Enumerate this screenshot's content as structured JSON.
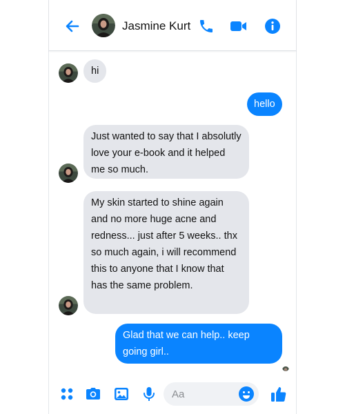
{
  "header": {
    "contact_name": "Jasmine Kurt",
    "icons": [
      "back-arrow-icon",
      "phone-icon",
      "video-camera-icon",
      "info-icon"
    ]
  },
  "messages": [
    {
      "direction": "incoming",
      "text": "hi"
    },
    {
      "direction": "outgoing",
      "text": "hello"
    },
    {
      "direction": "incoming",
      "text": "Just wanted to say that I absolutly love your e-book and it helped me so much."
    },
    {
      "direction": "incoming",
      "text": "My skin started to shine again and no more huge acne and redness... just after 5 weeks.. thx so much again, i will recommend this to anyone that I know that has the same problem."
    },
    {
      "direction": "outgoing",
      "text": "Glad that we can help.. keep going girl.."
    }
  ],
  "composer": {
    "placeholder": "Aa",
    "value": "",
    "icons": [
      "more-apps-icon",
      "camera-icon",
      "gallery-icon",
      "microphone-icon",
      "emoji-icon",
      "thumbs-up-icon"
    ]
  },
  "colors": {
    "accent": "#0a84ff",
    "incoming_bubble": "#e4e6eb",
    "outgoing_text": "#ffffff"
  }
}
